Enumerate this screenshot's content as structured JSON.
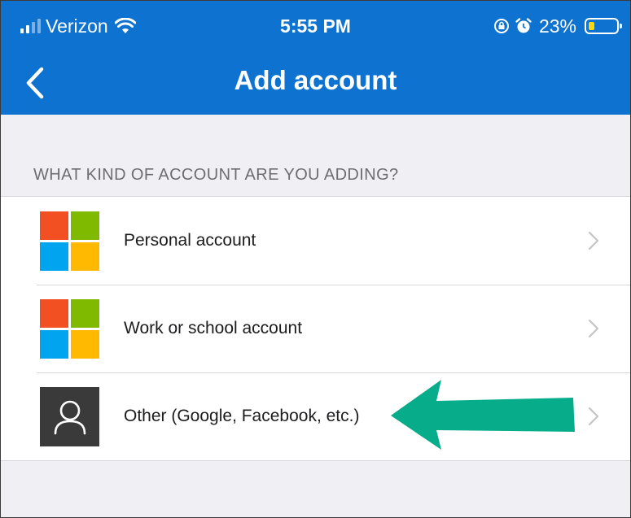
{
  "status_bar": {
    "carrier": "Verizon",
    "time": "5:55 PM",
    "battery_percent": "23%",
    "battery_level": 0.23,
    "icons": [
      "signal-icon",
      "wifi-icon",
      "rotation-lock-icon",
      "alarm-icon",
      "battery-icon"
    ]
  },
  "nav": {
    "title": "Add account",
    "back_icon": "chevron-left-icon"
  },
  "section": {
    "header": "WHAT KIND OF ACCOUNT ARE YOU ADDING?"
  },
  "accounts": [
    {
      "label": "Personal account",
      "icon": "microsoft-logo-icon"
    },
    {
      "label": "Work or school account",
      "icon": "microsoft-logo-icon"
    },
    {
      "label": "Other (Google, Facebook, etc.)",
      "icon": "person-icon"
    }
  ],
  "colors": {
    "header_blue": "#0e72d1",
    "ms_red": "#f25022",
    "ms_green": "#7fba00",
    "ms_blue": "#00a4ef",
    "ms_yellow": "#ffb900",
    "annotation_arrow": "#07ad8a"
  }
}
